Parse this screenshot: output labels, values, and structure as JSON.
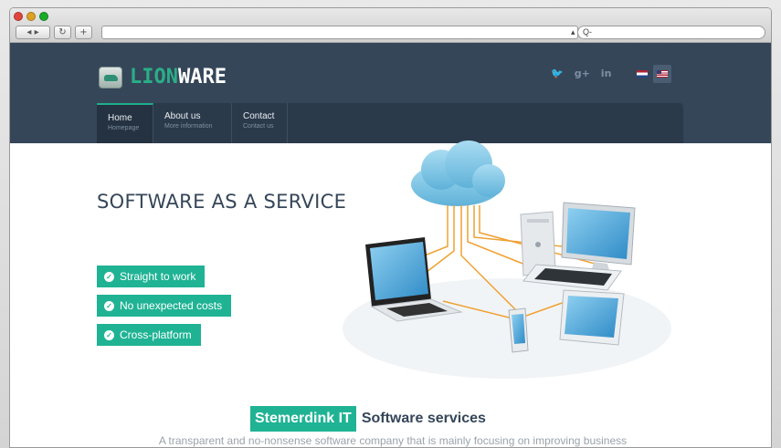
{
  "browser": {
    "back_forward_label": "◂ ▸",
    "reload_label": "↻",
    "new_tab_label": "+",
    "url_value": "",
    "url_arrow": "▴",
    "search_prefix": "Q-"
  },
  "header": {
    "logo_part1": "LION",
    "logo_part2": "WARE",
    "social": [
      "twitter-icon",
      "google-plus-icon",
      "linkedin-icon"
    ],
    "social_glyphs": [
      "🐦",
      "g+",
      "in"
    ],
    "languages": [
      "nl-flag-icon",
      "us-flag-icon"
    ]
  },
  "nav": {
    "items": [
      {
        "title": "Home",
        "subtitle": "Homepage"
      },
      {
        "title": "About us",
        "subtitle": "More information"
      },
      {
        "title": "Contact",
        "subtitle": "Contact us"
      }
    ]
  },
  "hero": {
    "title": "SOFTWARE AS A SERVICE",
    "features": [
      "Straight to work",
      "No unexpected costs",
      "Cross-platform"
    ],
    "check_glyph": "✓"
  },
  "intro": {
    "badge": "Stemerdink IT",
    "title_rest": "Software services",
    "text": "A transparent and no-nonsense software company that is mainly focusing on improving business"
  },
  "colors": {
    "header_bg": "#354659",
    "accent": "#1fb394",
    "nav_bg": "#2b3a4b"
  }
}
